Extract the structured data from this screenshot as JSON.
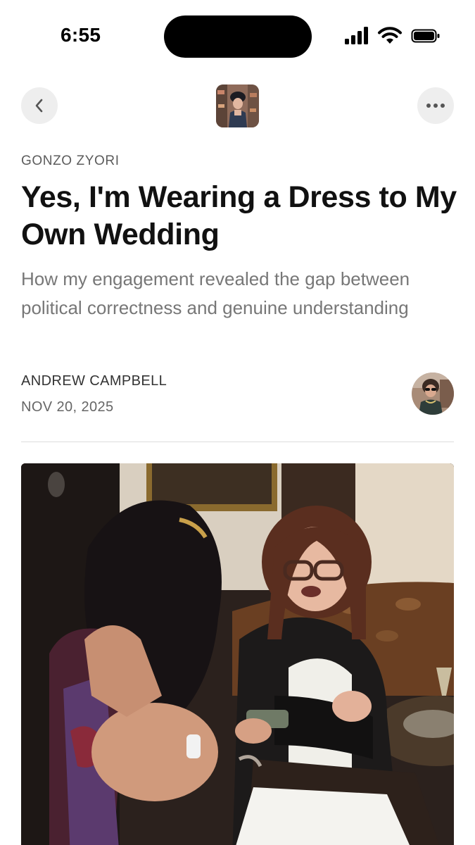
{
  "status_bar": {
    "time": "6:55",
    "icons": [
      "cellular-signal-icon",
      "wifi-icon",
      "battery-icon"
    ]
  },
  "nav": {
    "back_icon": "chevron-left-icon",
    "more_icon": "ellipsis-icon",
    "publication_logo": "publication-logo"
  },
  "article": {
    "publication": "GONZO ZYORI",
    "title": "Yes, I'm Wearing a Dress to My Own Wedding",
    "subtitle": "How my engagement revealed the gap between political correctness and genuine understanding",
    "author": "ANDREW CAMPBELL",
    "date": "NOV 20, 2025"
  },
  "colors": {
    "background": "#ffffff",
    "title": "#111111",
    "subtitle": "#777777",
    "meta": "#666666",
    "nav_button_bg": "#eeeeee"
  }
}
